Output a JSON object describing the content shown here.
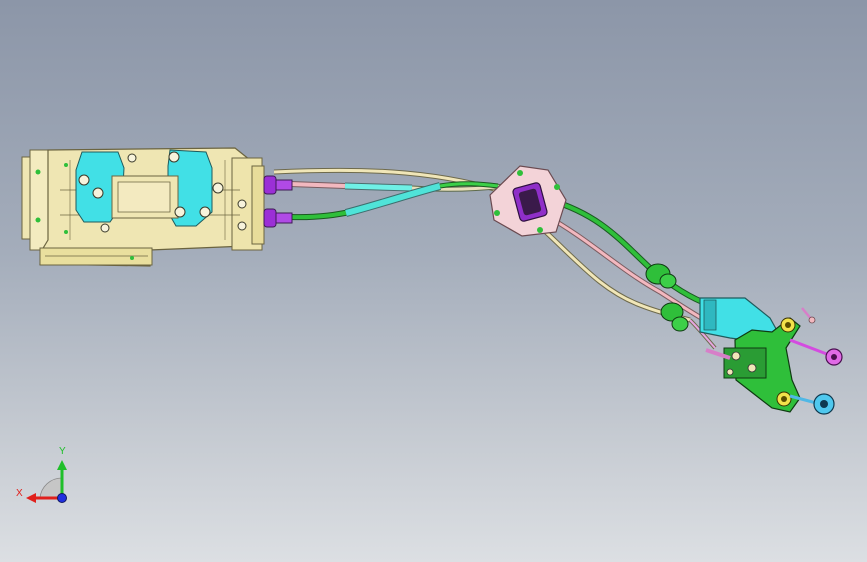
{
  "viewport": {
    "background_top": "#8c96a8",
    "background_bottom": "#dcdfe3"
  },
  "triad": {
    "x_label": "X",
    "y_label": "Y",
    "x_color": "#e0201c",
    "y_color": "#1fbf2a",
    "z_color": "#2030e0"
  },
  "colors": {
    "housing": "#efe6b3",
    "housing_edge": "#6b6440",
    "cyan_part": "#41e0e6",
    "purple_part": "#9b2fd6",
    "green_cable": "#2fbf3a",
    "pink_cable": "#f2b8bf",
    "cream_cable": "#f0e6b8",
    "teal_cable": "#4fe3d8",
    "bracket_pink": "#f3d3d8"
  }
}
